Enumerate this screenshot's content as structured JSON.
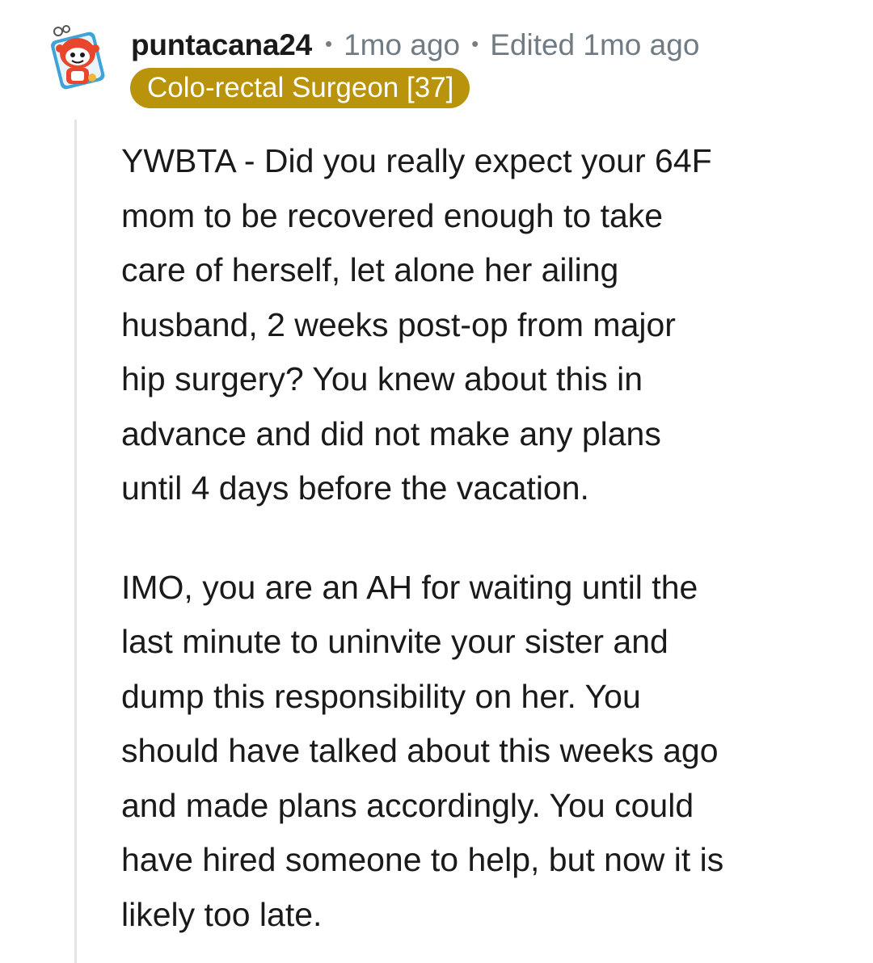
{
  "comment": {
    "avatar_icon": "snoo-avatar-icon",
    "username": "puntacana24",
    "separator": "•",
    "time": "1mo ago",
    "edited": "Edited 1mo ago",
    "flair": "Colo-rectal Surgeon [37]",
    "colors": {
      "flair_background": "#b8930b",
      "flair_text": "#ffffff",
      "meta_text": "#707b84",
      "thread_line": "#e2e4e6"
    },
    "paragraphs": [
      {
        "lines": [
          "YWBTA - Did you really expect your 64F",
          "mom to be recovered enough to take",
          "care of herself, let alone her ailing",
          "husband, 2 weeks post-op from major",
          "hip surgery? You knew about this in",
          "advance and did not make any plans",
          "until 4 days before the vacation."
        ]
      },
      {
        "lines": [
          "IMO, you are an AH for waiting until the",
          "last minute to uninvite your sister and",
          "dump this responsibility on her. You",
          "should have talked about this weeks ago",
          "and made plans accordingly. You could",
          "have hired someone to help, but now it is",
          "likely too late."
        ]
      }
    ]
  }
}
